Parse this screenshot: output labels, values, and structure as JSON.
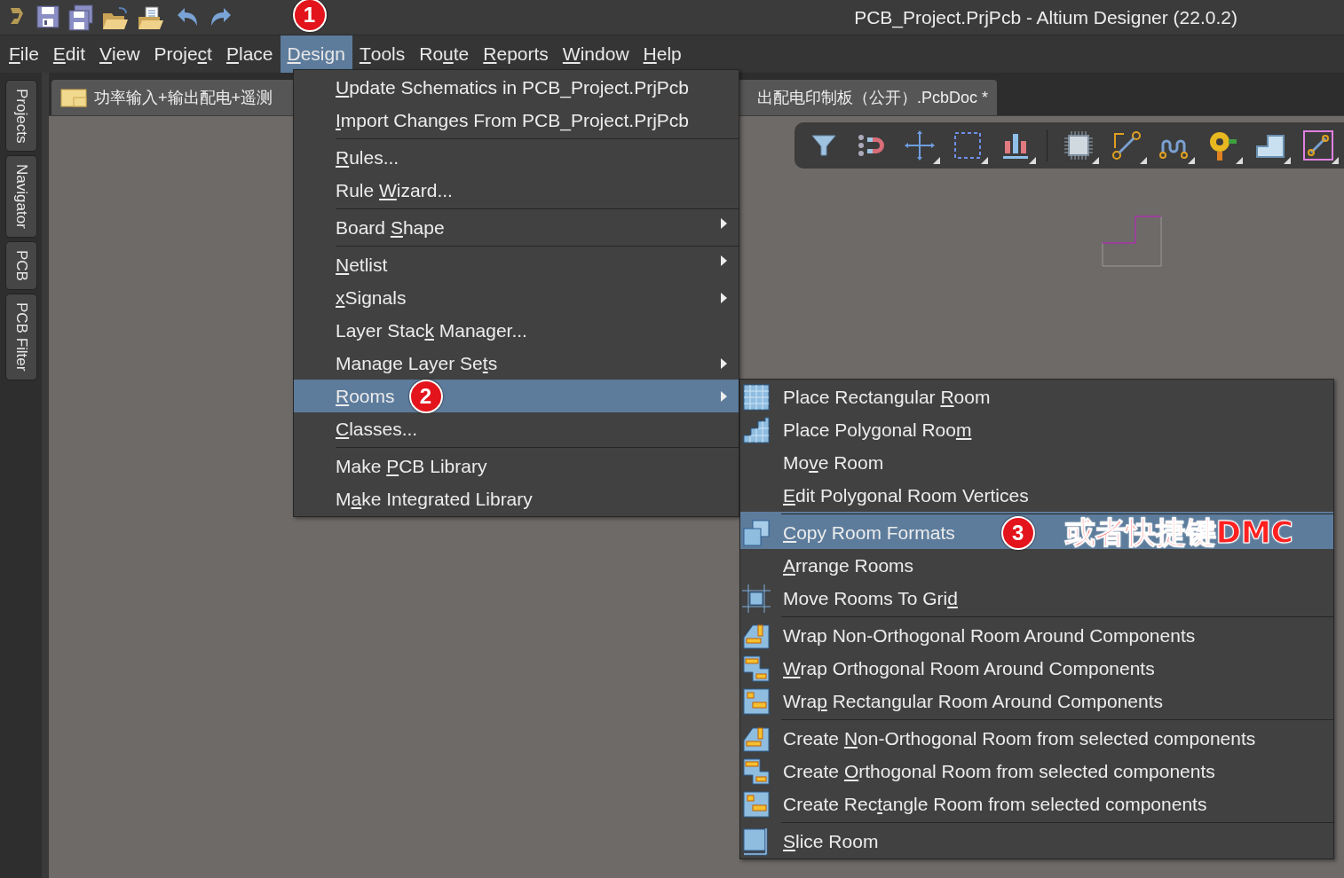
{
  "window": {
    "title": "PCB_Project.PrjPcb - Altium Designer (22.0.2)"
  },
  "menu_bar": [
    {
      "key": "F",
      "post": "ile",
      "selected": false
    },
    {
      "key": "E",
      "post": "dit",
      "selected": false
    },
    {
      "key": "V",
      "post": "iew",
      "selected": false
    },
    {
      "pre": "Proje",
      "key": "c",
      "post": "t",
      "selected": false
    },
    {
      "key": "P",
      "post": "lace",
      "selected": false
    },
    {
      "key": "D",
      "post": "esign",
      "selected": true,
      "badge": "1"
    },
    {
      "key": "T",
      "post": "ools",
      "selected": false
    },
    {
      "pre": "Ro",
      "key": "u",
      "post": "te",
      "selected": false
    },
    {
      "key": "R",
      "post": "eports",
      "selected": false
    },
    {
      "key": "W",
      "post": "indow",
      "selected": false
    },
    {
      "key": "H",
      "post": "elp",
      "selected": false
    }
  ],
  "side_panel_tabs": [
    "Projects",
    "Navigator",
    "PCB",
    "PCB Filter"
  ],
  "document_tab": {
    "text_start": "功率输入+输出配电+遥测",
    "text_end": "出配电印制板（公开）.PcbDoc *"
  },
  "design_menu": [
    {
      "key": "U",
      "post": "pdate Schematics in PCB_Project.PrjPcb",
      "selected": false,
      "has_submenu": false,
      "separator_before": false
    },
    {
      "key": "I",
      "post": "mport Changes From PCB_Project.PrjPcb",
      "selected": false,
      "has_submenu": false,
      "separator_before": false
    },
    {
      "key": "R",
      "post": "ules...",
      "selected": false,
      "has_submenu": false,
      "separator_before": true
    },
    {
      "pre": "Rule ",
      "key": "W",
      "post": "izard...",
      "selected": false,
      "has_submenu": false,
      "separator_before": false
    },
    {
      "pre": "Board ",
      "key": "S",
      "post": "hape",
      "selected": false,
      "has_submenu": true,
      "separator_before": true
    },
    {
      "key": "N",
      "post": "etlist",
      "selected": false,
      "has_submenu": true,
      "separator_before": true
    },
    {
      "key": "x",
      "post": "Signals",
      "selected": false,
      "has_submenu": true,
      "separator_before": false
    },
    {
      "pre": "Layer Stac",
      "key": "k",
      "post": " Manager...",
      "selected": false,
      "has_submenu": false,
      "separator_before": false
    },
    {
      "pre": "Manage Layer Se",
      "key": "t",
      "post": "s",
      "selected": false,
      "has_submenu": true,
      "separator_before": false
    },
    {
      "key": "R",
      "post": "ooms",
      "selected": true,
      "has_submenu": true,
      "separator_before": false,
      "badge": "2"
    },
    {
      "key": "C",
      "post": "lasses...",
      "selected": false,
      "has_submenu": false,
      "separator_before": false
    },
    {
      "pre": "Make ",
      "key": "P",
      "post": "CB Library",
      "selected": false,
      "has_submenu": false,
      "separator_before": true
    },
    {
      "pre": "M",
      "key": "a",
      "post": "ke Integrated Library",
      "selected": false,
      "has_submenu": false,
      "separator_before": false
    }
  ],
  "rooms_submenu": [
    {
      "kind": "rect-room",
      "pre": "Place Rectangular ",
      "key": "R",
      "post": "oom",
      "selected": false,
      "separator_before": false
    },
    {
      "kind": "poly-room",
      "pre": "Place Polygonal Roo",
      "key": "m",
      "selected": false,
      "separator_before": false
    },
    {
      "kind": "plain",
      "pre": "Mo",
      "key": "v",
      "post": "e Room",
      "selected": false,
      "separator_before": false
    },
    {
      "kind": "plain",
      "key": "E",
      "post": "dit Polygonal Room Vertices",
      "selected": false,
      "separator_before": false
    },
    {
      "kind": "copy",
      "key": "C",
      "post": "opy Room Formats",
      "selected": true,
      "separator_before": true,
      "badge": "3",
      "note": "或者快捷键DMC"
    },
    {
      "kind": "plain",
      "key": "A",
      "post": "rrange Rooms",
      "selected": false,
      "separator_before": false
    },
    {
      "kind": "grid",
      "pre": "Move Rooms To Gri",
      "key": "d",
      "selected": false,
      "separator_before": false
    },
    {
      "kind": "non-ortho",
      "pre": "Wrap Non-Ortho",
      "key": "g",
      "post": "onal Room Around Components",
      "selected": false,
      "separator_before": true
    },
    {
      "kind": "ortho",
      "key": "W",
      "post": "rap Orthogonal Room Around Components",
      "selected": false,
      "separator_before": false
    },
    {
      "kind": "rect-comp",
      "pre": "Wra",
      "key": "p",
      "post": " Rectangular Room Around Components",
      "selected": false,
      "separator_before": false
    },
    {
      "kind": "non-ortho",
      "pre": "Create ",
      "key": "N",
      "post": "on-Orthogonal Room from selected components",
      "selected": false,
      "separator_before": true
    },
    {
      "kind": "ortho",
      "pre": "Create ",
      "key": "O",
      "post": "rthogonal Room from selected components",
      "selected": false,
      "separator_before": false
    },
    {
      "kind": "rect-comp",
      "pre": "Create Rec",
      "key": "t",
      "post": "angle Room from selected components",
      "selected": false,
      "separator_before": false
    },
    {
      "kind": "slice",
      "key": "S",
      "post": "lice Room",
      "selected": false,
      "separator_before": true
    }
  ]
}
